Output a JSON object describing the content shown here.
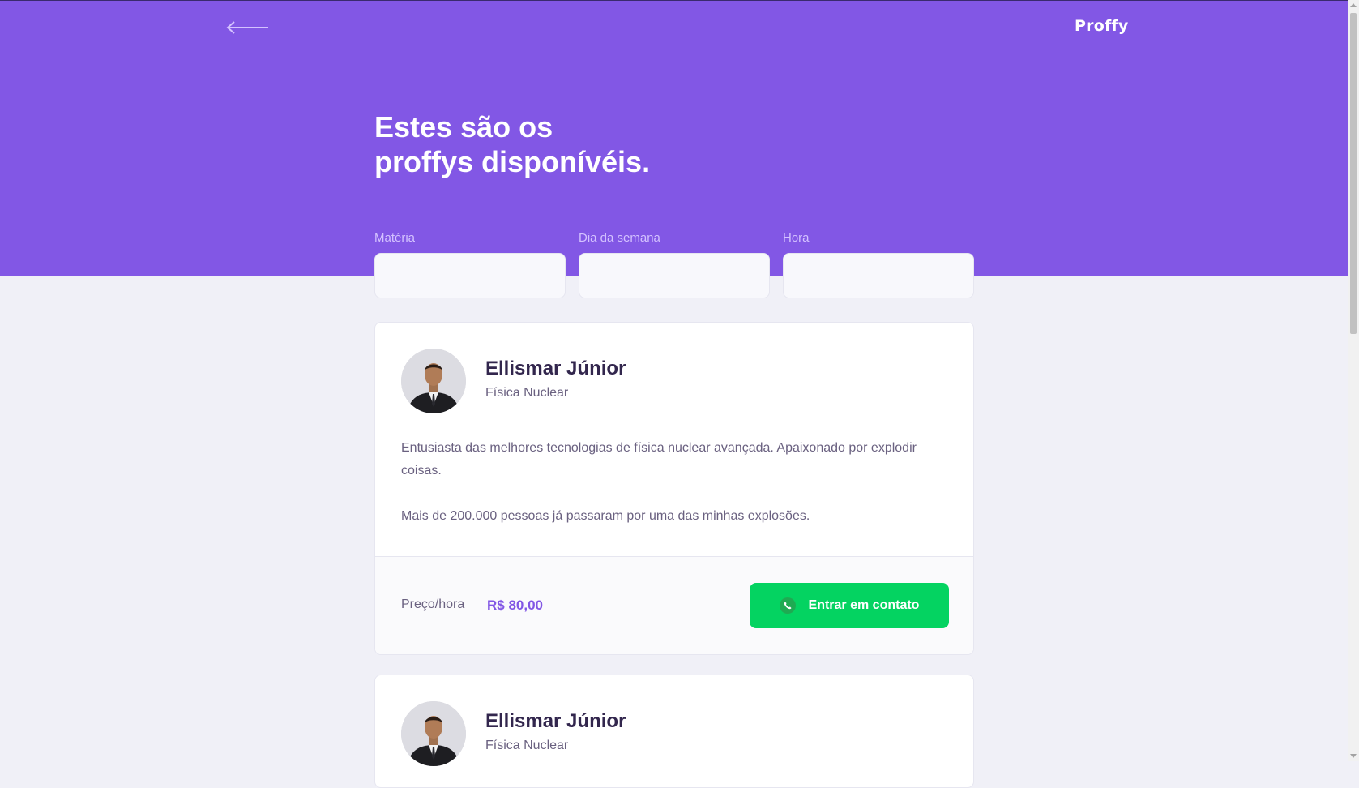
{
  "header": {
    "logo": "Proffy",
    "title_line1": "Estes são os",
    "title_line2": "proffys disponívéis."
  },
  "filters": {
    "subject_label": "Matéria",
    "weekday_label": "Dia da semana",
    "time_label": "Hora",
    "subject_value": "",
    "weekday_value": "",
    "time_value": ""
  },
  "teachers": [
    {
      "name": "Ellismar Júnior",
      "subject": "Física Nuclear",
      "bio_p1": "Entusiasta das melhores tecnologias de física nuclear avançada. Apaixonado por explodir coisas.",
      "bio_p2": "Mais de 200.000 pessoas já passaram por uma das minhas explosões.",
      "price_label": "Preço/hora",
      "price": "R$ 80,00",
      "contact_label": "Entrar em contato"
    },
    {
      "name": "Ellismar Júnior",
      "subject": "Física Nuclear"
    }
  ],
  "colors": {
    "primary": "#8257E5",
    "background": "#F0F0F7",
    "secondary": "#04D361",
    "title_text": "#32264D",
    "body_text": "#6A6180"
  },
  "icons": {
    "back": "arrow-left-icon",
    "contact": "whatsapp-icon"
  }
}
